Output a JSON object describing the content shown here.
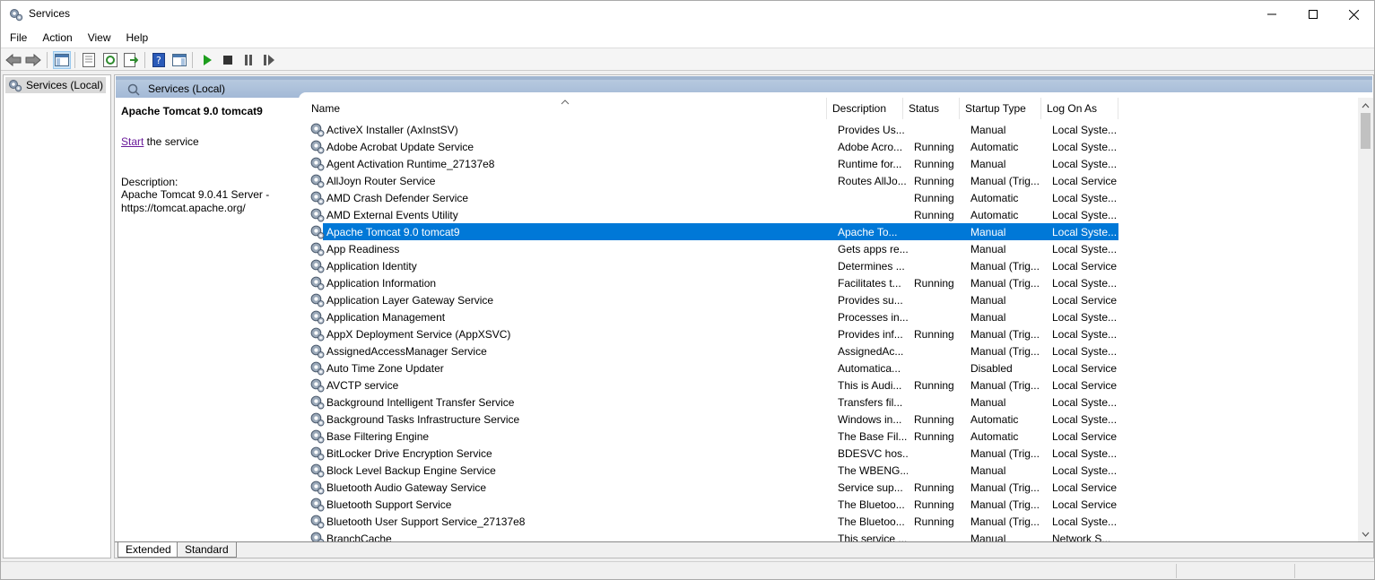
{
  "window": {
    "title": "Services"
  },
  "menu": [
    "File",
    "Action",
    "View",
    "Help"
  ],
  "tree": {
    "root_label": "Services (Local)"
  },
  "main": {
    "header_title": "Services (Local)",
    "selected_service": "Apache Tomcat 9.0 tomcat9",
    "start_link": "Start",
    "start_suffix": " the service",
    "description_label": "Description:",
    "description_lines": [
      "Apache Tomcat 9.0.41 Server -",
      "https://tomcat.apache.org/"
    ]
  },
  "columns": [
    "Name",
    "Description",
    "Status",
    "Startup Type",
    "Log On As"
  ],
  "services": [
    {
      "name": "ActiveX Installer (AxInstSV)",
      "description": "Provides Us...",
      "status": "",
      "startup": "Manual",
      "logon": "Local Syste..."
    },
    {
      "name": "Adobe Acrobat Update Service",
      "description": "Adobe Acro...",
      "status": "Running",
      "startup": "Automatic",
      "logon": "Local Syste..."
    },
    {
      "name": "Agent Activation Runtime_27137e8",
      "description": "Runtime for...",
      "status": "Running",
      "startup": "Manual",
      "logon": "Local Syste..."
    },
    {
      "name": "AllJoyn Router Service",
      "description": "Routes AllJo...",
      "status": "Running",
      "startup": "Manual (Trig...",
      "logon": "Local Service"
    },
    {
      "name": "AMD Crash Defender Service",
      "description": "",
      "status": "Running",
      "startup": "Automatic",
      "logon": "Local Syste..."
    },
    {
      "name": "AMD External Events Utility",
      "description": "",
      "status": "Running",
      "startup": "Automatic",
      "logon": "Local Syste..."
    },
    {
      "name": "Apache Tomcat 9.0 tomcat9",
      "description": "Apache To...",
      "status": "",
      "startup": "Manual",
      "logon": "Local Syste...",
      "selected": true
    },
    {
      "name": "App Readiness",
      "description": "Gets apps re...",
      "status": "",
      "startup": "Manual",
      "logon": "Local Syste..."
    },
    {
      "name": "Application Identity",
      "description": "Determines ...",
      "status": "",
      "startup": "Manual (Trig...",
      "logon": "Local Service"
    },
    {
      "name": "Application Information",
      "description": "Facilitates t...",
      "status": "Running",
      "startup": "Manual (Trig...",
      "logon": "Local Syste..."
    },
    {
      "name": "Application Layer Gateway Service",
      "description": "Provides su...",
      "status": "",
      "startup": "Manual",
      "logon": "Local Service"
    },
    {
      "name": "Application Management",
      "description": "Processes in...",
      "status": "",
      "startup": "Manual",
      "logon": "Local Syste..."
    },
    {
      "name": "AppX Deployment Service (AppXSVC)",
      "description": "Provides inf...",
      "status": "Running",
      "startup": "Manual (Trig...",
      "logon": "Local Syste..."
    },
    {
      "name": "AssignedAccessManager Service",
      "description": "AssignedAc...",
      "status": "",
      "startup": "Manual (Trig...",
      "logon": "Local Syste..."
    },
    {
      "name": "Auto Time Zone Updater",
      "description": "Automatica...",
      "status": "",
      "startup": "Disabled",
      "logon": "Local Service"
    },
    {
      "name": "AVCTP service",
      "description": "This is Audi...",
      "status": "Running",
      "startup": "Manual (Trig...",
      "logon": "Local Service"
    },
    {
      "name": "Background Intelligent Transfer Service",
      "description": "Transfers fil...",
      "status": "",
      "startup": "Manual",
      "logon": "Local Syste..."
    },
    {
      "name": "Background Tasks Infrastructure Service",
      "description": "Windows in...",
      "status": "Running",
      "startup": "Automatic",
      "logon": "Local Syste..."
    },
    {
      "name": "Base Filtering Engine",
      "description": "The Base Fil...",
      "status": "Running",
      "startup": "Automatic",
      "logon": "Local Service"
    },
    {
      "name": "BitLocker Drive Encryption Service",
      "description": "BDESVC hos...",
      "status": "",
      "startup": "Manual (Trig...",
      "logon": "Local Syste..."
    },
    {
      "name": "Block Level Backup Engine Service",
      "description": "The WBENG...",
      "status": "",
      "startup": "Manual",
      "logon": "Local Syste..."
    },
    {
      "name": "Bluetooth Audio Gateway Service",
      "description": "Service sup...",
      "status": "Running",
      "startup": "Manual (Trig...",
      "logon": "Local Service"
    },
    {
      "name": "Bluetooth Support Service",
      "description": "The Bluetoo...",
      "status": "Running",
      "startup": "Manual (Trig...",
      "logon": "Local Service"
    },
    {
      "name": "Bluetooth User Support Service_27137e8",
      "description": "The Bluetoo...",
      "status": "Running",
      "startup": "Manual (Trig...",
      "logon": "Local Syste..."
    },
    {
      "name": "BranchCache",
      "description": "This service ...",
      "status": "",
      "startup": "Manual",
      "logon": "Network S..."
    }
  ],
  "tabs": [
    "Extended",
    "Standard"
  ],
  "colors": {
    "selection": "#0078d7",
    "header_band": "#a9bfd9",
    "link": "#6a1b9a"
  }
}
